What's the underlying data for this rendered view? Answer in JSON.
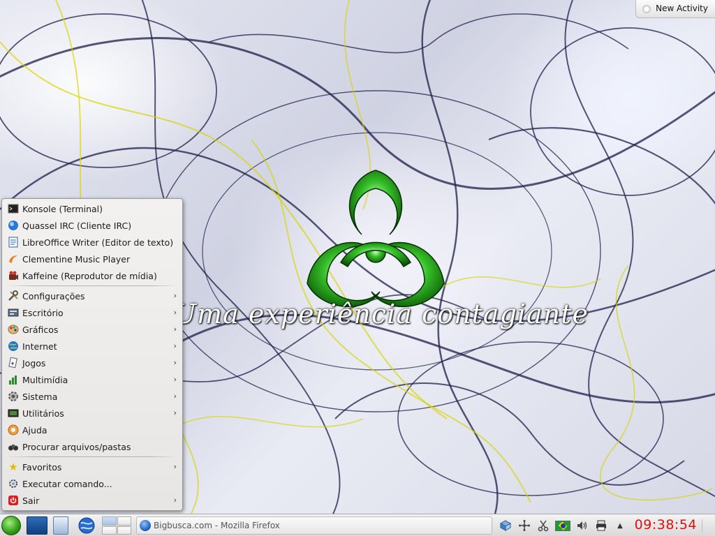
{
  "desktop": {
    "slogan": "Uma experiência contagiante",
    "new_activity_label": "New Activity"
  },
  "menu": {
    "favorites_apps": [
      {
        "label": "Konsole (Terminal)",
        "icon": "terminal-icon"
      },
      {
        "label": "Quassel IRC (Cliente IRC)",
        "icon": "irc-icon"
      },
      {
        "label": "LibreOffice Writer (Editor de texto)",
        "icon": "writer-icon"
      },
      {
        "label": "Clementine Music Player",
        "icon": "music-icon"
      },
      {
        "label": "Kaffeine (Reprodutor de mídia)",
        "icon": "media-player-icon"
      }
    ],
    "categories": [
      {
        "label": "Configurações",
        "icon": "settings-icon"
      },
      {
        "label": "Escritório",
        "icon": "office-icon"
      },
      {
        "label": "Gráficos",
        "icon": "graphics-icon"
      },
      {
        "label": "Internet",
        "icon": "internet-icon"
      },
      {
        "label": "Jogos",
        "icon": "games-icon"
      },
      {
        "label": "Multimídia",
        "icon": "multimedia-icon"
      },
      {
        "label": "Sistema",
        "icon": "system-icon"
      },
      {
        "label": "Utilitários",
        "icon": "utilities-icon"
      }
    ],
    "actions": [
      {
        "label": "Ajuda",
        "icon": "help-icon"
      },
      {
        "label": "Procurar arquivos/pastas",
        "icon": "binoculars-icon"
      }
    ],
    "bottom": [
      {
        "label": "Favoritos",
        "icon": "star-icon",
        "submenu": true
      },
      {
        "label": "Executar comando...",
        "icon": "run-icon",
        "submenu": false
      },
      {
        "label": "Sair",
        "icon": "power-icon",
        "submenu": true
      }
    ]
  },
  "taskbar": {
    "task_label": "Bigbusca.com - Mozilla Firefox",
    "clock": "09:38:54",
    "clock_color": "#d90f0f"
  }
}
